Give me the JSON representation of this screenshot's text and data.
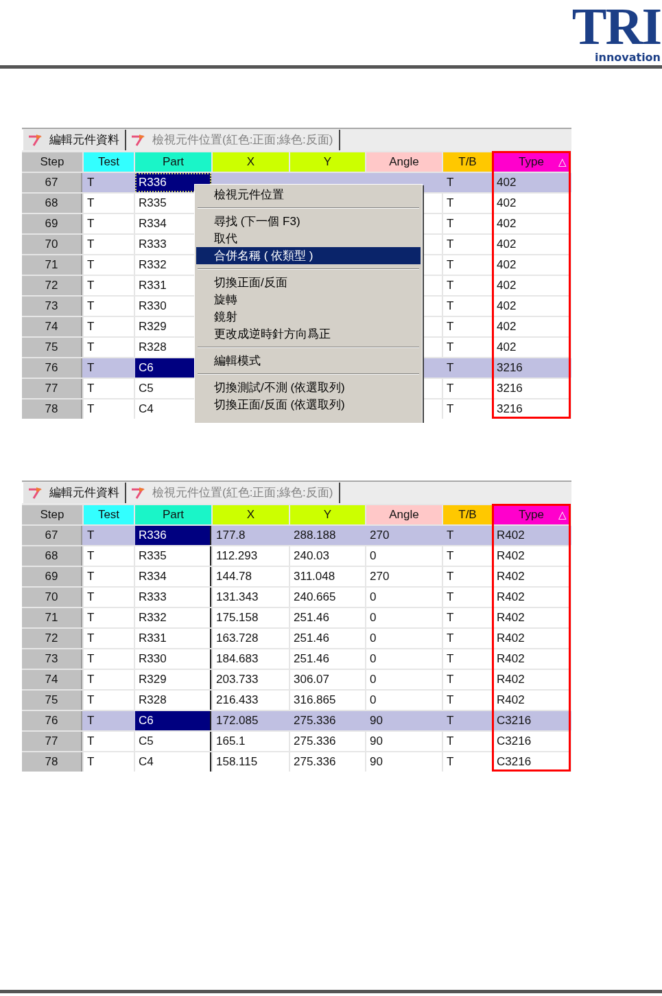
{
  "logo": {
    "mark": "TRI",
    "tagline": "innovation"
  },
  "screenshots": [
    {
      "tabs": [
        {
          "label": "編輯元件資料",
          "selected": true
        },
        {
          "label": "檢視元件位置(紅色:正面;綠色:反面)",
          "selected": false
        }
      ],
      "columns": [
        {
          "label": "Step",
          "color": "#c0c0c0",
          "highlighted": false,
          "active": false,
          "divider": false
        },
        {
          "label": "Test",
          "color": "#33ffff",
          "highlighted": false,
          "active": false,
          "divider": false
        },
        {
          "label": "Part",
          "color": "#1af5c8",
          "highlighted": false,
          "active": true,
          "divider": true
        },
        {
          "label": "X",
          "color": "#ccff00",
          "highlighted": false,
          "active": false,
          "divider": false
        },
        {
          "label": "Y",
          "color": "#ccff00",
          "highlighted": false,
          "active": false,
          "divider": false
        },
        {
          "label": "Angle",
          "color": "#ffc8c8",
          "highlighted": false,
          "active": false,
          "divider": false
        },
        {
          "label": "T/B",
          "color": "#ffc800",
          "highlighted": false,
          "active": false,
          "divider": false
        },
        {
          "label": "Type",
          "color": "#ff00cc",
          "highlighted": true,
          "active": false,
          "divider": false,
          "sort_mark": "△"
        }
      ],
      "rows": [
        {
          "cells": [
            "67",
            "T",
            "R336",
            null,
            null,
            null,
            "T",
            "402"
          ],
          "selected": true,
          "focused": true
        },
        {
          "cells": [
            "68",
            "T",
            "R335",
            null,
            null,
            null,
            "T",
            "402"
          ],
          "selected": false,
          "focused": false
        },
        {
          "cells": [
            "69",
            "T",
            "R334",
            null,
            null,
            null,
            "T",
            "402"
          ],
          "selected": false,
          "focused": false
        },
        {
          "cells": [
            "70",
            "T",
            "R333",
            null,
            null,
            null,
            "T",
            "402"
          ],
          "selected": false,
          "focused": false
        },
        {
          "cells": [
            "71",
            "T",
            "R332",
            null,
            null,
            null,
            "T",
            "402"
          ],
          "selected": false,
          "focused": false
        },
        {
          "cells": [
            "72",
            "T",
            "R331",
            null,
            null,
            null,
            "T",
            "402"
          ],
          "selected": false,
          "focused": false
        },
        {
          "cells": [
            "73",
            "T",
            "R330",
            null,
            null,
            null,
            "T",
            "402"
          ],
          "selected": false,
          "focused": false
        },
        {
          "cells": [
            "74",
            "T",
            "R329",
            null,
            null,
            null,
            "T",
            "402"
          ],
          "selected": false,
          "focused": false
        },
        {
          "cells": [
            "75",
            "T",
            "R328",
            null,
            null,
            null,
            "T",
            "402"
          ],
          "selected": false,
          "focused": false
        },
        {
          "cells": [
            "76",
            "T",
            "C6",
            null,
            null,
            null,
            "T",
            "3216"
          ],
          "selected": true,
          "focused": false
        },
        {
          "cells": [
            "77",
            "T",
            "C5",
            null,
            null,
            null,
            "T",
            "3216"
          ],
          "selected": false,
          "focused": false
        },
        {
          "cells": [
            "78",
            "T",
            "C4",
            null,
            null,
            null,
            "T",
            "3216"
          ],
          "selected": false,
          "focused": false
        }
      ],
      "context_menu": {
        "items": [
          {
            "kind": "item",
            "label": "檢視元件位置",
            "selected": false
          },
          {
            "kind": "separator"
          },
          {
            "kind": "item",
            "label": "尋找 (下一個 F3)",
            "selected": false
          },
          {
            "kind": "item",
            "label": "取代",
            "selected": false
          },
          {
            "kind": "item",
            "label": "合併名稱 ( 依類型 )",
            "selected": true
          },
          {
            "kind": "separator"
          },
          {
            "kind": "item",
            "label": "切換正面/反面",
            "selected": false
          },
          {
            "kind": "item",
            "label": "旋轉",
            "selected": false
          },
          {
            "kind": "item",
            "label": "鏡射",
            "selected": false
          },
          {
            "kind": "item",
            "label": "更改成逆時針方向爲正",
            "selected": false
          },
          {
            "kind": "separator"
          },
          {
            "kind": "item",
            "label": "編輯模式",
            "selected": false
          },
          {
            "kind": "separator"
          },
          {
            "kind": "item",
            "label": "切換測試/不測 (依選取列)",
            "selected": false
          },
          {
            "kind": "item",
            "label": "切換正面/反面 (依選取列)",
            "selected": false
          }
        ]
      }
    },
    {
      "tabs": [
        {
          "label": "編輯元件資料",
          "selected": true
        },
        {
          "label": "檢視元件位置(紅色:正面;綠色:反面)",
          "selected": false
        }
      ],
      "columns": [
        {
          "label": "Step",
          "color": "#c0c0c0",
          "highlighted": false,
          "active": false,
          "divider": false
        },
        {
          "label": "Test",
          "color": "#33ffff",
          "highlighted": false,
          "active": false,
          "divider": false
        },
        {
          "label": "Part",
          "color": "#1af5c8",
          "highlighted": false,
          "active": true,
          "divider": true
        },
        {
          "label": "X",
          "color": "#ccff00",
          "highlighted": false,
          "active": false,
          "divider": false
        },
        {
          "label": "Y",
          "color": "#ccff00",
          "highlighted": false,
          "active": false,
          "divider": false
        },
        {
          "label": "Angle",
          "color": "#ffc8c8",
          "highlighted": false,
          "active": false,
          "divider": false
        },
        {
          "label": "T/B",
          "color": "#ffc800",
          "highlighted": false,
          "active": false,
          "divider": false
        },
        {
          "label": "Type",
          "color": "#ff00cc",
          "highlighted": true,
          "active": false,
          "divider": false,
          "sort_mark": "△"
        }
      ],
      "rows": [
        {
          "cells": [
            "67",
            "T",
            "R336",
            "177.8",
            "288.188",
            "270",
            "T",
            "R402"
          ],
          "selected": true,
          "focused": false
        },
        {
          "cells": [
            "68",
            "T",
            "R335",
            "112.293",
            "240.03",
            "0",
            "T",
            "R402"
          ],
          "selected": false,
          "focused": false
        },
        {
          "cells": [
            "69",
            "T",
            "R334",
            "144.78",
            "311.048",
            "270",
            "T",
            "R402"
          ],
          "selected": false,
          "focused": false
        },
        {
          "cells": [
            "70",
            "T",
            "R333",
            "131.343",
            "240.665",
            "0",
            "T",
            "R402"
          ],
          "selected": false,
          "focused": false
        },
        {
          "cells": [
            "71",
            "T",
            "R332",
            "175.158",
            "251.46",
            "0",
            "T",
            "R402"
          ],
          "selected": false,
          "focused": false
        },
        {
          "cells": [
            "72",
            "T",
            "R331",
            "163.728",
            "251.46",
            "0",
            "T",
            "R402"
          ],
          "selected": false,
          "focused": false
        },
        {
          "cells": [
            "73",
            "T",
            "R330",
            "184.683",
            "251.46",
            "0",
            "T",
            "R402"
          ],
          "selected": false,
          "focused": false
        },
        {
          "cells": [
            "74",
            "T",
            "R329",
            "203.733",
            "306.07",
            "0",
            "T",
            "R402"
          ],
          "selected": false,
          "focused": false
        },
        {
          "cells": [
            "75",
            "T",
            "R328",
            "216.433",
            "316.865",
            "0",
            "T",
            "R402"
          ],
          "selected": false,
          "focused": false
        },
        {
          "cells": [
            "76",
            "T",
            "C6",
            "172.085",
            "275.336",
            "90",
            "T",
            "C3216"
          ],
          "selected": true,
          "focused": false
        },
        {
          "cells": [
            "77",
            "T",
            "C5",
            "165.1",
            "275.336",
            "90",
            "T",
            "C3216"
          ],
          "selected": false,
          "focused": false
        },
        {
          "cells": [
            "78",
            "T",
            "C4",
            "158.115",
            "275.336",
            "90",
            "T",
            "C3216"
          ],
          "selected": false,
          "focused": false
        }
      ]
    }
  ]
}
